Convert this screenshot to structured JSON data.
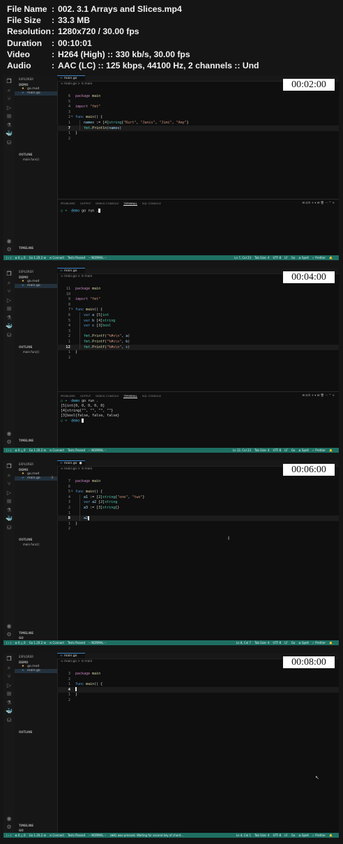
{
  "info": [
    {
      "key": "File Name",
      "value": "002. 3.1 Arrays and Slices.mp4"
    },
    {
      "key": "File Size",
      "value": "33.3 MB"
    },
    {
      "key": "Resolution",
      "value": "1280x720 / 30.00 fps"
    },
    {
      "key": "Duration",
      "value": "00:10:01"
    },
    {
      "key": "Video",
      "value": "H264 (High) :: 330 kb/s, 30.00 fps"
    },
    {
      "key": "Audio",
      "value": "AAC (LC) :: 125 kbps, 44100 Hz, 2 channels :: Und"
    }
  ],
  "colors": {
    "status_bar": "#1e6f63",
    "terminal_arrow": "#3fb58f",
    "terminal_dir": "#4fc1e9",
    "string": "#ce9178",
    "keyword": "#c586c0"
  },
  "activity_icons": [
    "files-icon",
    "search-icon",
    "source-control-icon",
    "run-debug-icon",
    "extensions-icon",
    "testing-icon",
    "docker-icon",
    "database-icon",
    "account-icon",
    "settings-icon"
  ],
  "frames": [
    {
      "timestamp": "00:02:00",
      "sidebar": {
        "explorer": "EXPLORER",
        "folder": "DEMO",
        "files": [
          {
            "icon": "mod",
            "name": "go.mod"
          },
          {
            "icon": "go",
            "name": "main.go"
          }
        ],
        "outline": "OUTLINE",
        "outline_item": "main  func()",
        "timeline": "TIMELINE",
        "extra": ""
      },
      "tab": {
        "name": "main.go",
        "dot": ""
      },
      "breadcrumb": "∞ main.go > ⊙ main",
      "code": [
        {
          "ln": "6",
          "text": "package main"
        },
        {
          "ln": "5",
          "text": ""
        },
        {
          "ln": "4",
          "text": "import \"fmt\""
        },
        {
          "ln": "3",
          "text": ""
        },
        {
          "ln": "2",
          "text": "func main() {",
          "fold": "∨"
        },
        {
          "ln": "1",
          "text": "    names := [4]string{\"Kurt\", \"Janis\", \"Jimi\", \"Amy\"}"
        },
        {
          "ln": "7",
          "text": "    fmt.Println(names)",
          "current": true
        },
        {
          "ln": "1",
          "text": "}"
        },
        {
          "ln": "2",
          "text": ""
        }
      ],
      "panel": {
        "tabs": [
          "PROBLEMS",
          "OUTPUT",
          "DEBUG CONSOLE",
          "TERMINAL",
          "SQL CONSOLE"
        ],
        "active": "TERMINAL",
        "controls": "⊞ zsh  +  ▾  ⊞  🗑  ···  ^  ×"
      },
      "terminal": [
        {
          "prompt": true,
          "dir": "demo",
          "cmd": "go run .",
          "cursor": true
        }
      ],
      "status_left": [
        "⟨ › ⟩",
        "⊗ 0 △ 0",
        "Go 1.20.2 ⊞",
        "⟲ Connect",
        "Tests Passed",
        "-- NORMAL --"
      ],
      "status_right": [
        "Ln 7, Col 23",
        "Tab Size: 4",
        "UTF-8",
        "LF",
        "Go",
        "⊗ Spell",
        "✓ Prettier",
        "🔔"
      ]
    },
    {
      "timestamp": "00:04:00",
      "sidebar": {
        "explorer": "EXPLORER",
        "folder": "DEMO",
        "files": [
          {
            "icon": "mod",
            "name": "go.mod"
          },
          {
            "icon": "go",
            "name": "main.go"
          }
        ],
        "outline": "OUTLINE",
        "outline_item": "main  func()",
        "timeline": "TIMELINE",
        "extra": ""
      },
      "tab": {
        "name": "main.go",
        "dot": ""
      },
      "breadcrumb": "∞ main.go > ⊙ main",
      "code": [
        {
          "ln": "11",
          "text": "package main"
        },
        {
          "ln": "10",
          "text": ""
        },
        {
          "ln": "9",
          "text": "import \"fmt\""
        },
        {
          "ln": "8",
          "text": ""
        },
        {
          "ln": "7",
          "text": "func main() {",
          "fold": "∨"
        },
        {
          "ln": "6",
          "text": "    var a [5]int"
        },
        {
          "ln": "5",
          "text": "    var b [4]string"
        },
        {
          "ln": "4",
          "text": "    var c [3]bool"
        },
        {
          "ln": "3",
          "text": ""
        },
        {
          "ln": "2",
          "text": "    fmt.Printf(\"%#v\\n\", a)"
        },
        {
          "ln": "1",
          "text": "    fmt.Printf(\"%#v\\n\", b)"
        },
        {
          "ln": "12",
          "text": "    fmt.Printf(\"%#v\\n\", c)",
          "current": true
        },
        {
          "ln": "1",
          "text": "}"
        },
        {
          "ln": "2",
          "text": ""
        }
      ],
      "panel": {
        "tabs": [
          "PROBLEMS",
          "OUTPUT",
          "DEBUG CONSOLE",
          "TERMINAL",
          "SQL CONSOLE"
        ],
        "active": "TERMINAL",
        "controls": "⊞ zsh  +  ▾  ⊞  🗑  ···  ^  ×"
      },
      "terminal": [
        {
          "prompt": true,
          "dir": "demo",
          "cmd": "go run ."
        },
        {
          "text": "[5]int{0, 0, 0, 0, 0}"
        },
        {
          "text": "[4]string{\"\", \"\", \"\", \"\"}"
        },
        {
          "text": "[3]bool{false, false, false}"
        },
        {
          "prompt": true,
          "dir": "demo",
          "cmd": "",
          "cursor": true
        }
      ],
      "status_left": [
        "⟨ › ⟩",
        "⊗ 0 △ 0",
        "Go 1.20.2 ⊞",
        "⟲ Connect",
        "Tests Passed",
        "-- NORMAL --"
      ],
      "status_right": [
        "Ln 12, Col 23",
        "Tab Size: 4",
        "UTF-8",
        "LF",
        "Go",
        "⊗ Spell",
        "✓ Prettier",
        "🔔"
      ]
    },
    {
      "timestamp": "00:06:00",
      "sidebar": {
        "explorer": "EXPLORER",
        "folder": "DEMO",
        "files": [
          {
            "icon": "mod",
            "name": "go.mod"
          },
          {
            "icon": "go",
            "name": "main.go",
            "badge": "3"
          }
        ],
        "outline": "OUTLINE",
        "outline_item": "main  func()",
        "timeline": "TIMELINE",
        "extra": "GO"
      },
      "tab": {
        "name": "main.go",
        "dot": "●"
      },
      "breadcrumb": "∞ main.go > ⊙ main",
      "code": [
        {
          "ln": "7",
          "text": "package main"
        },
        {
          "ln": "6",
          "text": ""
        },
        {
          "ln": "5",
          "text": "func main() {",
          "fold": "∨"
        },
        {
          "ln": "4",
          "text": "    a1 := [2]string{\"one\", \"two\"}"
        },
        {
          "ln": "3",
          "text": "    var a2 [2]string"
        },
        {
          "ln": "2",
          "text": "    a3 := [3]string{}"
        },
        {
          "ln": "1",
          "text": ""
        },
        {
          "ln": "8",
          "text": "    a2",
          "current": true,
          "caret": true
        },
        {
          "ln": "1",
          "text": "}"
        },
        {
          "ln": "2",
          "text": ""
        }
      ],
      "panel": null,
      "terminal": [],
      "status_left": [
        "⟨ › ⟩",
        "⊗ 0 △ 0",
        "Go 1.20.2 ⊞",
        "⟲ Connect",
        "Tests Passed",
        "-- NORMAL --"
      ],
      "status_right": [
        "Ln 8, Col 7",
        "Tab Size: 4",
        "UTF-8",
        "LF",
        "Go",
        "⊗ Spell",
        "✓ Prettier",
        "🔔"
      ]
    },
    {
      "timestamp": "00:08:00",
      "sidebar": {
        "explorer": "EXPLORER",
        "folder": "DEMO",
        "files": [
          {
            "icon": "mod",
            "name": "go.mod"
          },
          {
            "icon": "go",
            "name": "main.go"
          }
        ],
        "outline": "OUTLINE",
        "outline_item": "",
        "timeline": "TIMELINE",
        "extra": "GO"
      },
      "tab": {
        "name": "main.go",
        "dot": ""
      },
      "breadcrumb": "∞ main.go > ⊙ main",
      "code": [
        {
          "ln": "3",
          "text": "package main"
        },
        {
          "ln": "2",
          "text": ""
        },
        {
          "ln": "1",
          "text": "func main() {"
        },
        {
          "ln": "4",
          "text": "",
          "current": true,
          "caret": true
        },
        {
          "ln": "1",
          "text": "}"
        },
        {
          "ln": "2",
          "text": ""
        }
      ],
      "panel": null,
      "terminal": [],
      "status_left": [
        "⟨ › ⟩",
        "⊗ 0 △ 0",
        "Go 1.20.2 ⊞",
        "⟲ Connect",
        "Tests Passed",
        "-- NORMAL --",
        "(⌘K) was pressed. Waiting for second key of chord..."
      ],
      "status_right": [
        "Ln 4, Col 1",
        "Tab Size: 4",
        "UTF-8",
        "LF",
        "Go",
        "⊗ Spell",
        "✓ Prettier",
        "🔔"
      ]
    }
  ]
}
